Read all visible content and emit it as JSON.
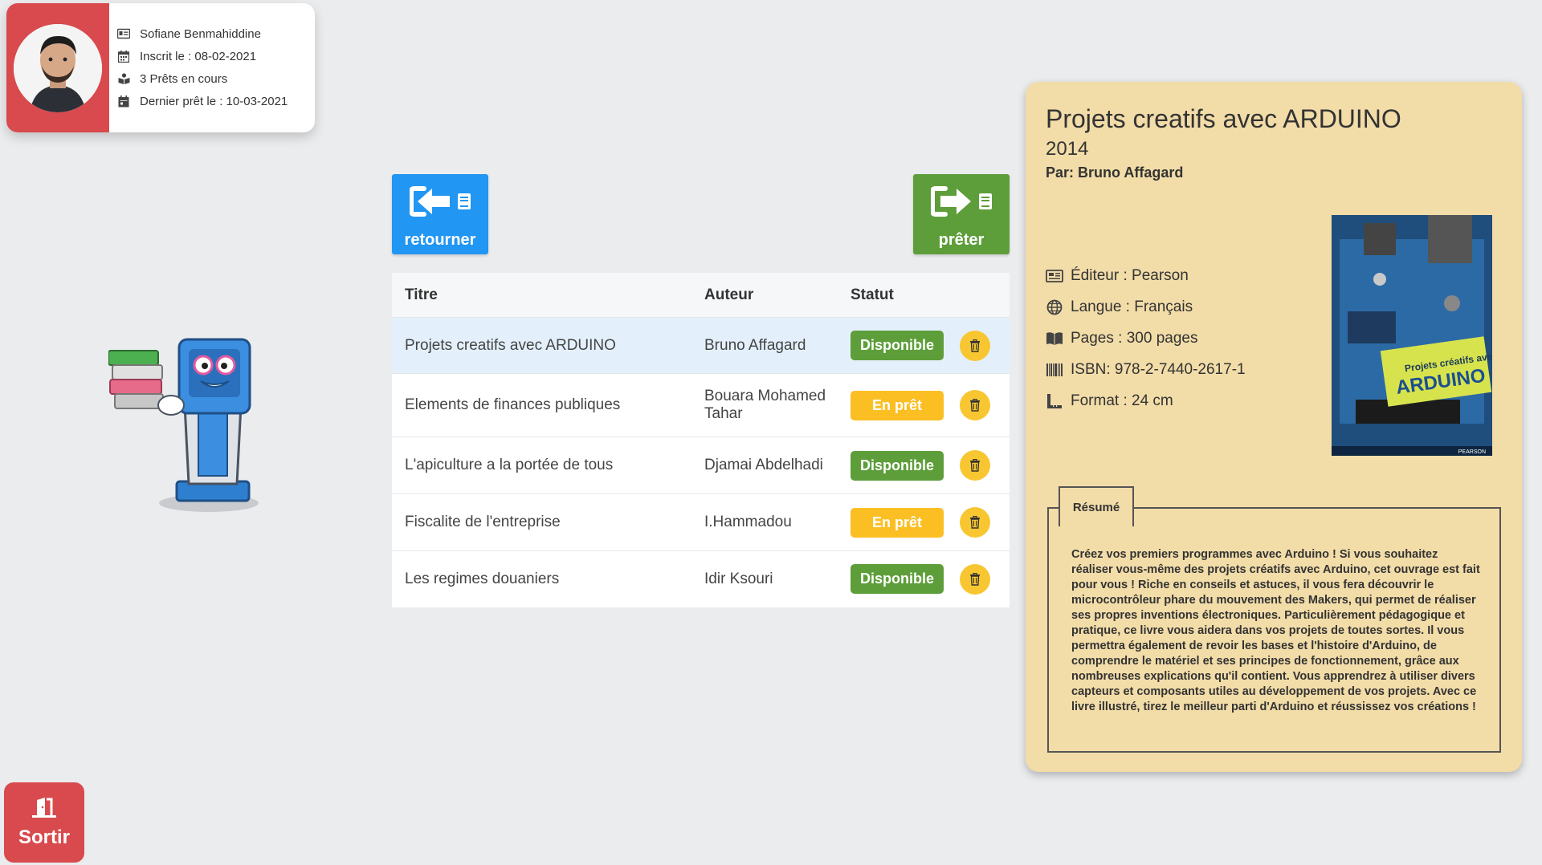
{
  "user": {
    "name": "Sofiane Benmahiddine",
    "registered": "Inscrit le : 08-02-2021",
    "loans": "3 Prêts en cours",
    "last_loan": "Dernier prêt le : 10-03-2021"
  },
  "actions": {
    "return_label": "retourner",
    "lend_label": "prêter"
  },
  "table": {
    "headers": {
      "title": "Titre",
      "author": "Auteur",
      "status": "Statut"
    },
    "rows": [
      {
        "title": "Projets creatifs avec ARDUINO",
        "author": "Bruno Affagard",
        "status": "Disponible",
        "state": "available"
      },
      {
        "title": "Elements de finances publiques",
        "author": "Bouara Mohamed Tahar",
        "status": "En prêt",
        "state": "loaned"
      },
      {
        "title": "L'apiculture a la portée de tous",
        "author": "Djamai Abdelhadi",
        "status": "Disponible",
        "state": "available"
      },
      {
        "title": "Fiscalite de l'entreprise",
        "author": "I.Hammadou",
        "status": "En prêt",
        "state": "loaned"
      },
      {
        "title": "Les regimes douaniers",
        "author": "Idir Ksouri",
        "status": "Disponible",
        "state": "available"
      }
    ]
  },
  "detail": {
    "title": "Projets creatifs avec ARDUINO",
    "year": "2014",
    "author": "Par: Bruno Affagard",
    "publisher": "Éditeur : Pearson",
    "language": "Langue : Français",
    "pages": "Pages : 300 pages",
    "isbn": "ISBN: 978-2-7440-2617-1",
    "format": "Format : 24 cm",
    "cover": {
      "line1": "Projets créatifs avec",
      "line2": "ARDUINO",
      "publisher": "PEARSON"
    },
    "resume_label": "Résumé",
    "resume": "Créez vos premiers programmes avec Arduino ! Si vous souhaitez réaliser vous-même des projets créatifs avec Arduino, cet ouvrage est fait pour vous ! Riche en conseils et astuces, il vous fera découvrir le microcontrôleur phare du mouvement des Makers, qui permet de réaliser ses propres inventions électroniques. Particulièrement pédagogique et pratique, ce livre vous aidera dans vos projets de toutes sortes. Il vous permettra également de revoir les bases et l'histoire d'Arduino, de comprendre le matériel et ses principes de fonctionnement, grâce aux nombreuses explications qu'il contient. Vous apprendrez à utiliser divers capteurs et composants utiles au développement de vos projets. Avec ce livre illustré, tirez le meilleur parti d'Arduino et réussissez vos créations !"
  },
  "exit": {
    "label": "Sortir"
  },
  "colors": {
    "red": "#d84a4d",
    "blue": "#2196f3",
    "green": "#5e9e3a",
    "yellow": "#fbbf24",
    "panel": "#f2dca8"
  }
}
